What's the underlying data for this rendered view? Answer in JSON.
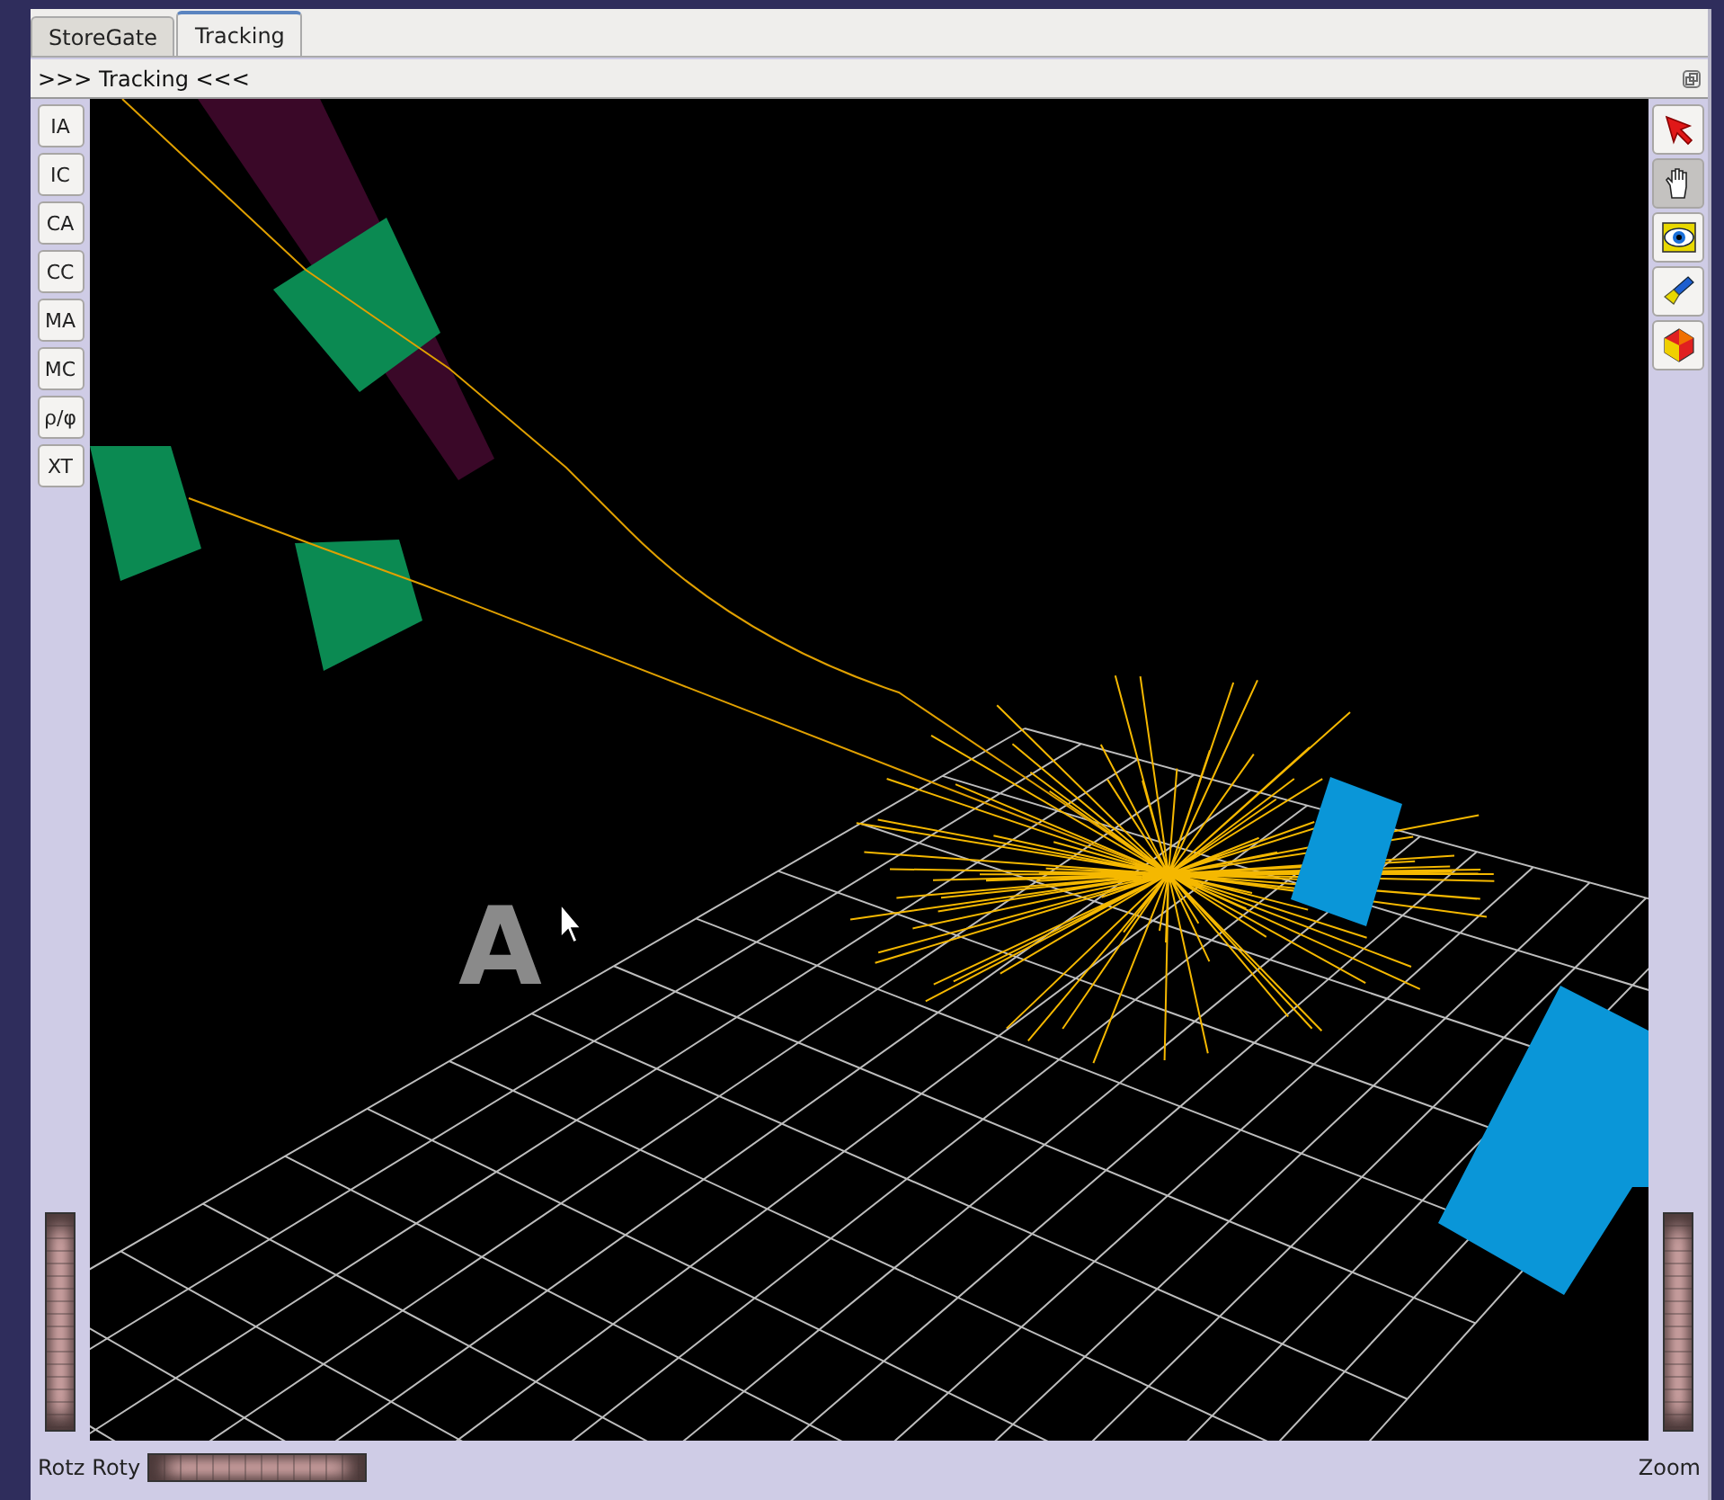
{
  "tabs": [
    {
      "label": "StoreGate",
      "selected": false
    },
    {
      "label": "Tracking",
      "selected": true
    }
  ],
  "panel": {
    "title": ">>> Tracking <<<"
  },
  "view_buttons": [
    "IA",
    "IC",
    "CA",
    "CC",
    "MA",
    "MC",
    "ρ/φ",
    "XT"
  ],
  "tools": [
    {
      "kind": "pointer",
      "selected": false
    },
    {
      "kind": "hand",
      "selected": true
    },
    {
      "kind": "eye",
      "selected": false
    },
    {
      "kind": "flashlight",
      "selected": false
    },
    {
      "kind": "cube",
      "selected": false
    }
  ],
  "scene": {
    "logo": "A"
  },
  "bottom": {
    "left_labels": [
      "Rotz",
      "Roty"
    ],
    "right_label": "Zoom"
  }
}
